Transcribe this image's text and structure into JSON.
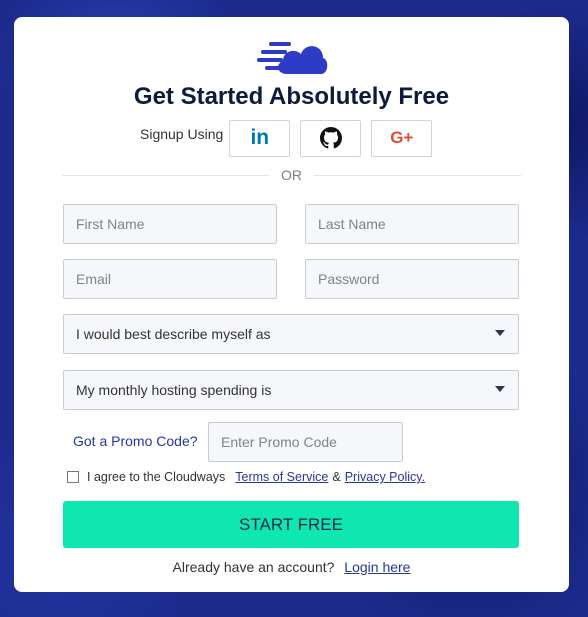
{
  "title": "Get Started Absolutely Free",
  "signup": {
    "label": "Signup Using",
    "linkedin": "in",
    "google": "G+"
  },
  "divider": "OR",
  "fields": {
    "first_name": "First Name",
    "last_name": "Last Name",
    "email": "Email",
    "password": "Password",
    "describe": "I would best describe myself as",
    "spending": "My monthly hosting spending is",
    "promo_placeholder": "Enter Promo Code"
  },
  "promo_label": "Got a Promo Code?",
  "agree": {
    "text": "I agree to the Cloudways",
    "terms": "Terms of Service",
    "amp": "&",
    "privacy": "Privacy Policy."
  },
  "start_button": "START FREE",
  "login": {
    "text": "Already have an account?",
    "link": "Login here"
  },
  "colors": {
    "accent": "#0fe7b0",
    "brand": "#2735a0",
    "title": "#0c1a3e",
    "linkedin": "#0077b5",
    "google": "#dd4b39"
  },
  "icons": [
    "cloud-logo-icon",
    "linkedin-icon",
    "github-icon",
    "google-plus-icon",
    "caret-down-icon"
  ]
}
